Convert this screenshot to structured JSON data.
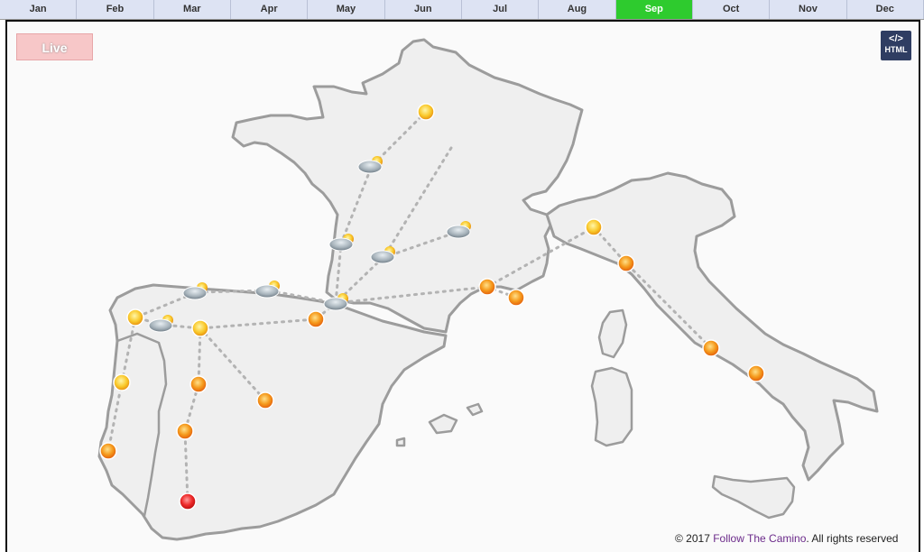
{
  "months": [
    {
      "label": "Jan",
      "active": false
    },
    {
      "label": "Feb",
      "active": false
    },
    {
      "label": "Mar",
      "active": false
    },
    {
      "label": "Apr",
      "active": false
    },
    {
      "label": "May",
      "active": false
    },
    {
      "label": "Jun",
      "active": false
    },
    {
      "label": "Jul",
      "active": false
    },
    {
      "label": "Aug",
      "active": false
    },
    {
      "label": "Sep",
      "active": true
    },
    {
      "label": "Oct",
      "active": false
    },
    {
      "label": "Nov",
      "active": false
    },
    {
      "label": "Dec",
      "active": false
    }
  ],
  "live_label": "Live",
  "embed_button": {
    "code": "</>",
    "label": "HTML"
  },
  "footer": {
    "copyright": "© 2017 ",
    "brand": "Follow The Camino",
    "rights": ". All rights reserved"
  },
  "weather_markers": [
    {
      "id": "paris",
      "icon": "sun-icon",
      "temp": "warm"
    },
    {
      "id": "normandy",
      "icon": "cloud-sun-icon",
      "temp": "mild"
    },
    {
      "id": "loire",
      "icon": "cloud-sun-icon",
      "temp": "mild"
    },
    {
      "id": "bordeaux",
      "icon": "cloud-sun-icon",
      "temp": "mild"
    },
    {
      "id": "limoges",
      "icon": "cloud-sun-icon",
      "temp": "mild"
    },
    {
      "id": "bayonne",
      "icon": "cloud-sun-icon",
      "temp": "mild"
    },
    {
      "id": "santander",
      "icon": "cloud-sun-icon",
      "temp": "mild"
    },
    {
      "id": "oviedo",
      "icon": "cloud-sun-icon",
      "temp": "mild"
    },
    {
      "id": "santiago",
      "icon": "sun-icon",
      "temp": "warm"
    },
    {
      "id": "galicia-inland",
      "icon": "cloud-sun-icon",
      "temp": "mild"
    },
    {
      "id": "leon",
      "icon": "sun-icon",
      "temp": "warm"
    },
    {
      "id": "pamplona",
      "icon": "sun-icon",
      "temp": "hot"
    },
    {
      "id": "porto",
      "icon": "sun-icon",
      "temp": "warm"
    },
    {
      "id": "salamanca",
      "icon": "sun-icon",
      "temp": "hot"
    },
    {
      "id": "madrid",
      "icon": "sun-icon",
      "temp": "hot"
    },
    {
      "id": "caceres",
      "icon": "sun-icon",
      "temp": "hot"
    },
    {
      "id": "lisbon",
      "icon": "sun-icon",
      "temp": "hot"
    },
    {
      "id": "seville",
      "icon": "sun-icon",
      "temp": "very-hot"
    },
    {
      "id": "marseille",
      "icon": "sun-icon",
      "temp": "hot"
    },
    {
      "id": "nice",
      "icon": "sun-icon",
      "temp": "hot"
    },
    {
      "id": "turin",
      "icon": "sun-icon",
      "temp": "warm"
    },
    {
      "id": "la-spezia",
      "icon": "sun-icon",
      "temp": "hot"
    },
    {
      "id": "rome",
      "icon": "sun-icon",
      "temp": "hot"
    },
    {
      "id": "naples",
      "icon": "sun-icon",
      "temp": "hot"
    }
  ],
  "colors": {
    "active_month": "#2ecb2e",
    "month_bg": "#dde3f3",
    "land": "#efefef",
    "border": "#9c9c9c",
    "route": "#b3b3b3",
    "warm": "#f7c326",
    "hot": "#f28a12",
    "very_hot": "#e81c1c"
  }
}
